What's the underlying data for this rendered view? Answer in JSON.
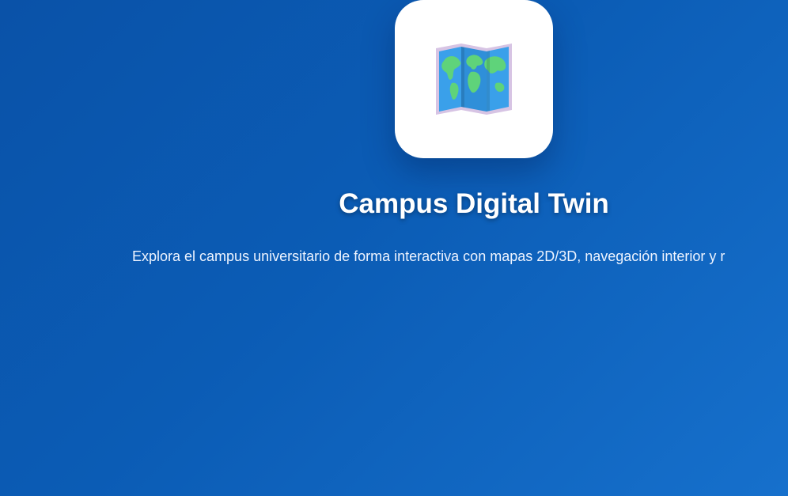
{
  "hero": {
    "icon": "world-map-icon",
    "title": "Campus Digital Twin",
    "subtitle": "Explora el campus universitario de forma interactiva con mapas 2D/3D, navegación interior y r"
  },
  "colors": {
    "background_start": "#0a52a8",
    "background_end": "#1670cc",
    "tile": "#ffffff",
    "text": "#ffffff"
  }
}
